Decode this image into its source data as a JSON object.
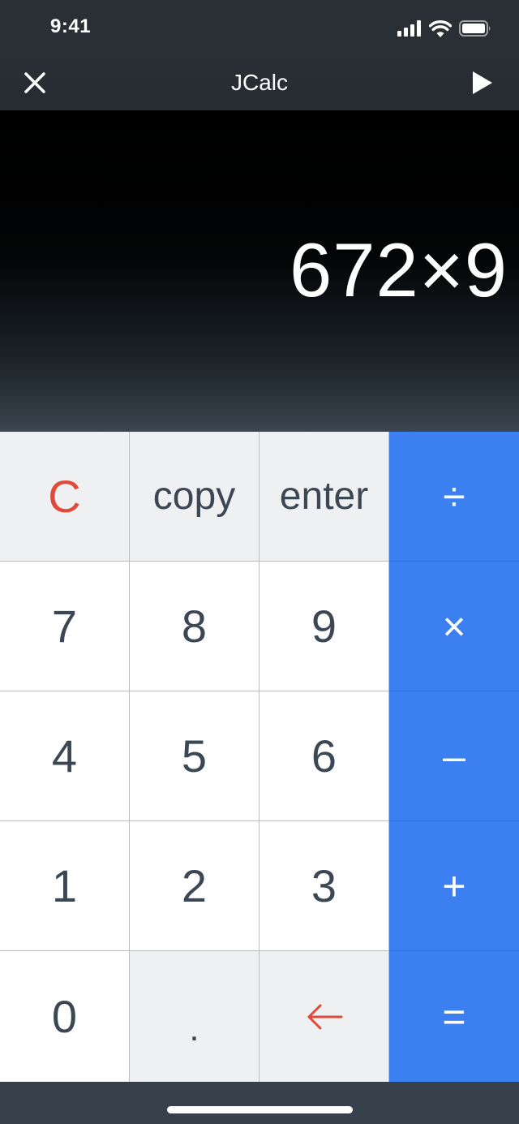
{
  "status": {
    "time": "9:41",
    "icons": [
      "signal-icon",
      "wifi-icon",
      "battery-icon"
    ]
  },
  "nav": {
    "title": "JCalc",
    "left_icon": "close-icon",
    "right_icon": "play-icon"
  },
  "display": {
    "value": "672×9"
  },
  "keypad": {
    "clear": "C",
    "copy": "copy",
    "enter": "enter",
    "divide": "÷",
    "seven": "7",
    "eight": "8",
    "nine": "9",
    "multiply": "×",
    "four": "4",
    "five": "5",
    "six": "6",
    "minus": "–",
    "one": "1",
    "two": "2",
    "three": "3",
    "plus": "+",
    "zero": "0",
    "decimal": ".",
    "backspace_icon": "left-arrow-icon",
    "equals": "="
  },
  "colors": {
    "operator_blue": "#3b7ff0",
    "accent_red": "#e04a3a",
    "key_text": "#3b4754",
    "function_gray": "#eff0f1",
    "bar_dark": "#2a2f35"
  }
}
